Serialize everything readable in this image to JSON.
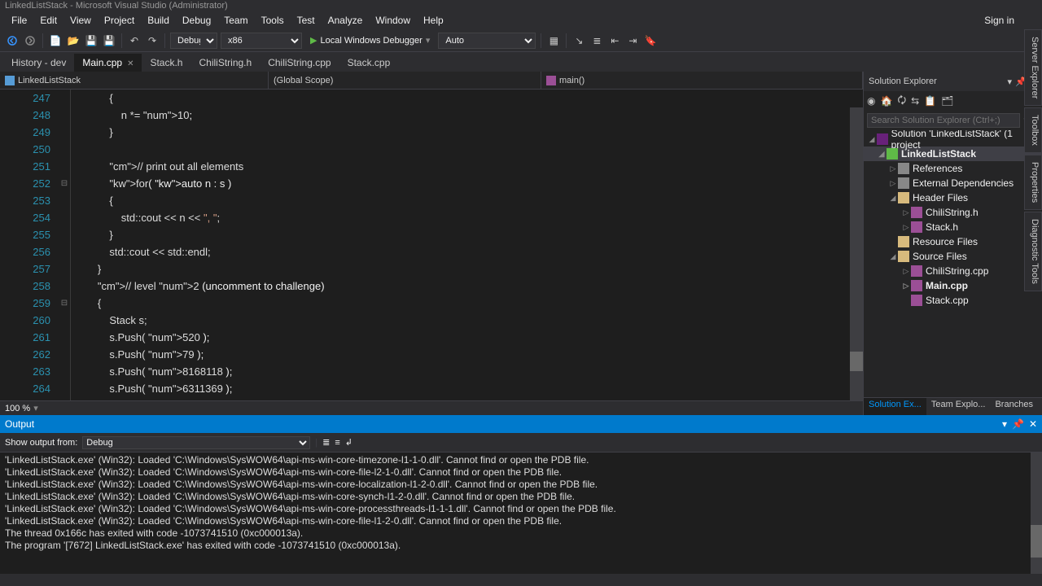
{
  "window_title": "LinkedListStack - Microsoft Visual Studio  (Administrator)",
  "signin": "Sign in",
  "menu": [
    "File",
    "Edit",
    "View",
    "Project",
    "Build",
    "Debug",
    "Team",
    "Tools",
    "Test",
    "Analyze",
    "Window",
    "Help"
  ],
  "toolbar": {
    "config": "Debug",
    "platform": "x86",
    "debugger": "Local Windows Debugger",
    "run_mode": "Auto"
  },
  "tabs": [
    {
      "label": "History - dev",
      "active": false
    },
    {
      "label": "Main.cpp",
      "active": true,
      "closeable": true
    },
    {
      "label": "Stack.h",
      "active": false
    },
    {
      "label": "ChiliString.h",
      "active": false
    },
    {
      "label": "ChiliString.cpp",
      "active": false
    },
    {
      "label": "Stack.cpp",
      "active": false
    }
  ],
  "nav": {
    "project": "LinkedListStack",
    "scope": "(Global Scope)",
    "func": "main()"
  },
  "code_start_line": 247,
  "code_lines": [
    "            {",
    "                n *= 10;",
    "            }",
    "",
    "            // print out all elements",
    "            for( auto n : s )",
    "            {",
    "                std::cout << n << \", \";",
    "            }",
    "            std::cout << std::endl;",
    "        }",
    "        // level 2 (uncomment to challenge)",
    "        {",
    "            Stack s;",
    "            s.Push( 520 );",
    "            s.Push( 79 );",
    "            s.Push( 8168118 );",
    "            s.Push( 6311369 );"
  ],
  "zoom": "100 %",
  "solution_explorer": {
    "title": "Solution Explorer",
    "search_placeholder": "Search Solution Explorer (Ctrl+;)",
    "root": "Solution 'LinkedListStack' (1 project",
    "project": "LinkedListStack",
    "refs": "References",
    "ext": "External Dependencies",
    "headers": "Header Files",
    "header_items": [
      "ChiliString.h",
      "Stack.h"
    ],
    "resource": "Resource Files",
    "source": "Source Files",
    "source_items": [
      "ChiliString.cpp",
      "Main.cpp",
      "Stack.cpp"
    ],
    "bottom_tabs": [
      "Solution Ex...",
      "Team Explo...",
      "Branches"
    ]
  },
  "right_tabs": [
    "Server Explorer",
    "Toolbox",
    "Properties",
    "Diagnostic Tools"
  ],
  "output": {
    "title": "Output",
    "from_label": "Show output from:",
    "from": "Debug",
    "lines": [
      "'LinkedListStack.exe' (Win32): Loaded 'C:\\Windows\\SysWOW64\\api-ms-win-core-timezone-l1-1-0.dll'. Cannot find or open the PDB file.",
      "'LinkedListStack.exe' (Win32): Loaded 'C:\\Windows\\SysWOW64\\api-ms-win-core-file-l2-1-0.dll'. Cannot find or open the PDB file.",
      "'LinkedListStack.exe' (Win32): Loaded 'C:\\Windows\\SysWOW64\\api-ms-win-core-localization-l1-2-0.dll'. Cannot find or open the PDB file.",
      "'LinkedListStack.exe' (Win32): Loaded 'C:\\Windows\\SysWOW64\\api-ms-win-core-synch-l1-2-0.dll'. Cannot find or open the PDB file.",
      "'LinkedListStack.exe' (Win32): Loaded 'C:\\Windows\\SysWOW64\\api-ms-win-core-processthreads-l1-1-1.dll'. Cannot find or open the PDB file.",
      "'LinkedListStack.exe' (Win32): Loaded 'C:\\Windows\\SysWOW64\\api-ms-win-core-file-l1-2-0.dll'. Cannot find or open the PDB file.",
      "The thread 0x166c has exited with code -1073741510 (0xc000013a).",
      "The program '[7672] LinkedListStack.exe' has exited with code -1073741510 (0xc000013a)."
    ]
  }
}
